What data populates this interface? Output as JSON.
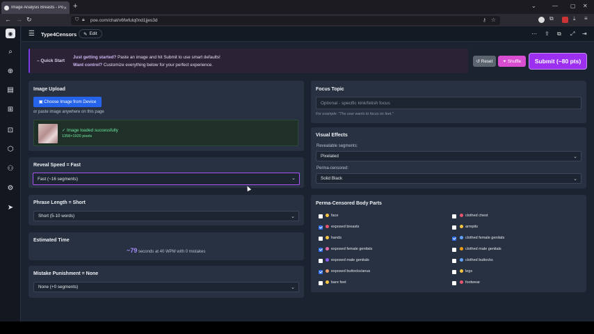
{
  "browser": {
    "tab_title": "Image Analysis Breasts - Poe",
    "url": "poe.com/chat/v6fwfutq0nd1jjes3d"
  },
  "app": {
    "title": "Type4Censors",
    "edit_label": "Edit"
  },
  "banner": {
    "quick_start": "Quick Start",
    "line1_bold": "Just getting started?",
    "line1_rest": " Paste an image and hit Submit to use smart defaults!",
    "line2_bold": "Want control?",
    "line2_rest": " Customize everything below for your perfect experience."
  },
  "actions": {
    "reset": "Reset",
    "shuffle": "Shuffle",
    "submit": "Submit (~80 pts)"
  },
  "image_upload": {
    "title": "Image Upload",
    "choose_label": "Choose Image from Device",
    "paste_hint": "or paste image anywhere on this page",
    "loaded_text": "✓ Image loaded successfully",
    "dimensions": "1358×1920 pixels"
  },
  "reveal_speed": {
    "title": "Reveal Speed = Fast",
    "selected": "Fast (~16 segments)"
  },
  "phrase_length": {
    "title": "Phrase Length = Short",
    "selected": "Short (5-10 words)"
  },
  "estimated_time": {
    "title": "Estimated Time",
    "value": "~79",
    "suffix": " seconds at 40 WPM with 0 mistakes"
  },
  "mistake_punishment": {
    "title": "Mistake Punishment = None",
    "selected": "None (+0 segments)"
  },
  "focus_topic": {
    "title": "Focus Topic",
    "placeholder": "Optional - specific kink/fetish focus",
    "example": "For example: \"The user wants to focus on feet.\""
  },
  "visual_effects": {
    "title": "Visual Effects",
    "revealable_label": "Revealable segments:",
    "revealable_selected": "Pixelated",
    "perma_label": "Perma-censored:",
    "perma_selected": "Solid Black"
  },
  "body_parts": {
    "title": "Perma-Censored Body Parts",
    "left": [
      {
        "label": "face",
        "checked": false,
        "color": "#f5c542"
      },
      {
        "label": "exposed breasts",
        "checked": true,
        "color": "#e8556d"
      },
      {
        "label": "hands",
        "checked": false,
        "color": "#f5c542"
      },
      {
        "label": "exposed female genitals",
        "checked": true,
        "color": "#e86ba5"
      },
      {
        "label": "exposed male genitals",
        "checked": false,
        "color": "#8b5cf6"
      },
      {
        "label": "exposed buttocks/anus",
        "checked": true,
        "color": "#f0a070"
      },
      {
        "label": "bare feet",
        "checked": false,
        "color": "#f5c542"
      }
    ],
    "right": [
      {
        "label": "clothed chest",
        "checked": false,
        "color": "#e8556d"
      },
      {
        "label": "armpits",
        "checked": false,
        "color": "#f5c542"
      },
      {
        "label": "clothed female genitals",
        "checked": true,
        "color": "#60a5fa"
      },
      {
        "label": "clothed male genitals",
        "checked": false,
        "color": "#f59e0b"
      },
      {
        "label": "clothed buttocks",
        "checked": false,
        "color": "#60a5fa"
      },
      {
        "label": "legs",
        "checked": false,
        "color": "#f5c542"
      },
      {
        "label": "footwear",
        "checked": false,
        "color": "#e8556d"
      }
    ]
  }
}
